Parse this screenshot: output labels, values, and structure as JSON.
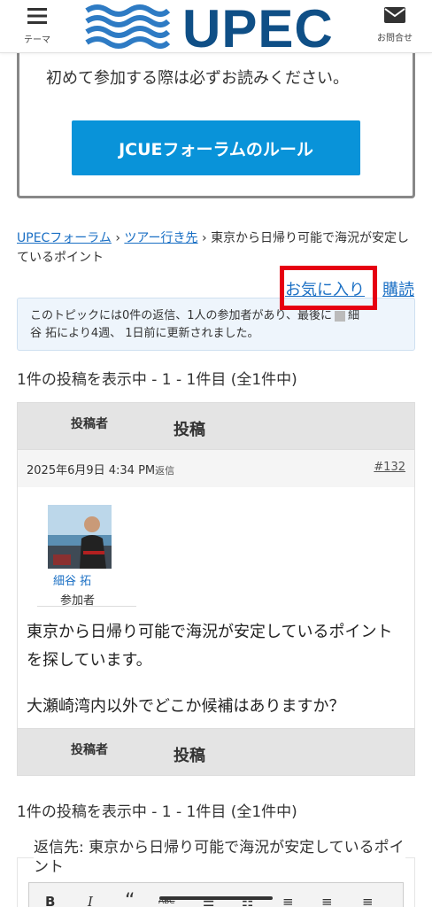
{
  "header": {
    "theme_label": "テーマ",
    "contact_label": "お問合せ",
    "logo_text": "UPEC"
  },
  "rules": {
    "notice": "初めて参加する際は必ずお読みください。",
    "button_label": "JCUEフォーラムのルール"
  },
  "breadcrumb": {
    "forum": "UPECフォーラム",
    "separator": " › ",
    "category": "ツアー行き先",
    "current": "東京から日帰り可能で海況が安定しているポイント"
  },
  "actions": {
    "favorite": "お気に入り",
    "subscribe": "購読"
  },
  "topic_info": {
    "line1_a": "このトピックには0件の返信、1人の参加者があり、最後に",
    "line1_b": "細",
    "line2": "谷 拓により4週、 1日前に更新されました。"
  },
  "post_count_top": "1件の投稿を表示中 - 1 - 1件目 (全1件中)",
  "post_count_bottom": "1件の投稿を表示中 - 1 - 1件目 (全1件中)",
  "table": {
    "col_author": "投稿者",
    "col_post": "投稿"
  },
  "post": {
    "date": "2025年6月9日 4:34 PM",
    "reply_label": "返信",
    "id": "#132",
    "author_name": "細谷 拓",
    "author_role": "参加者",
    "paragraph1": "東京から日帰り可能で海況が安定しているポイントを探しています。",
    "paragraph2": "大瀬崎湾内以外でどこか候補はありますか？"
  },
  "reply": {
    "title": "返信先: 東京から日帰り可能で海況が安定しているポイント",
    "toolbar": [
      "B",
      "I",
      "“",
      "ABC",
      "☰",
      "☷",
      "≡",
      "≡",
      "≡"
    ]
  },
  "colors": {
    "brand": "#0f4f86",
    "button": "#0993d9",
    "highlight": "#e60012",
    "link": "#1a6fc4"
  }
}
